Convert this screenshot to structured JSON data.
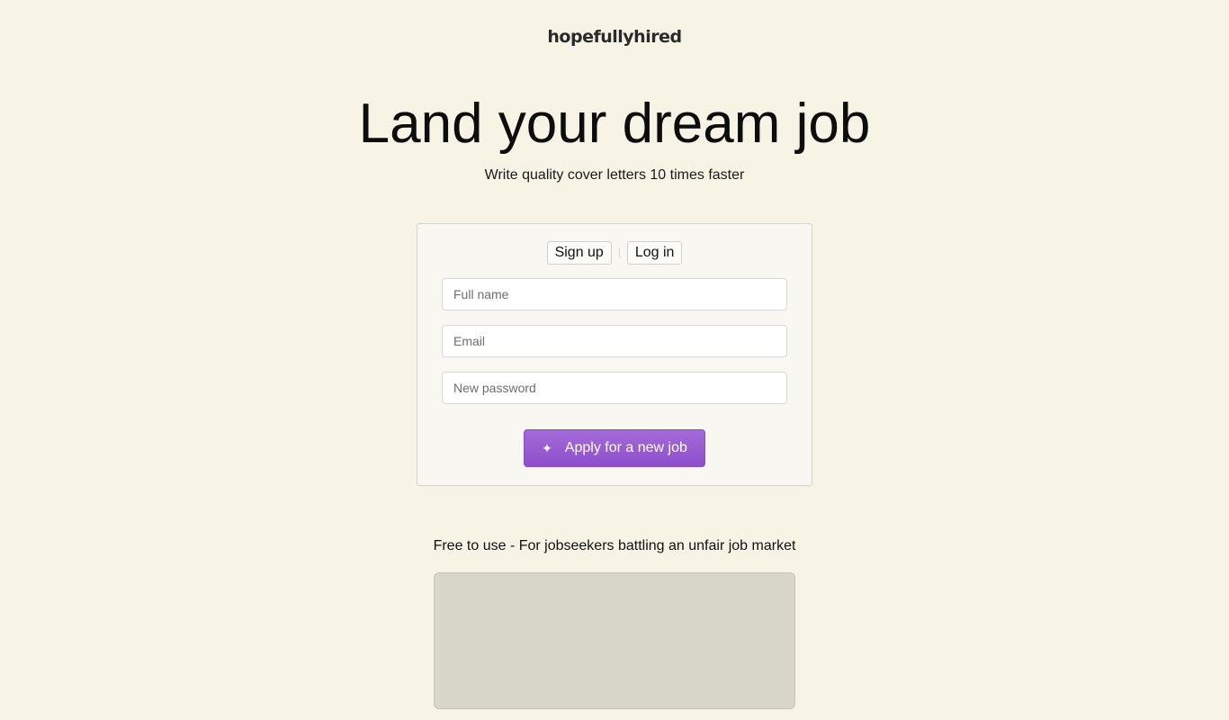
{
  "brand": {
    "logo_text": "hopefullyhired"
  },
  "hero": {
    "headline": "Land your dream job",
    "subheadline": "Write quality cover letters 10 times faster"
  },
  "auth": {
    "tabs": [
      {
        "label": "Sign up"
      },
      {
        "label": "Log in"
      }
    ],
    "fields": {
      "full_name": {
        "placeholder": "Full name",
        "value": ""
      },
      "email": {
        "placeholder": "Email",
        "value": ""
      },
      "new_password": {
        "placeholder": "New password",
        "value": ""
      }
    },
    "submit": {
      "label": "Apply for a new job",
      "icon": "sparkle-icon"
    }
  },
  "tagline": "Free to use - For jobseekers battling an unfair job market",
  "colors": {
    "background": "#f7f4e6",
    "accent": "#9b5fd3",
    "placeholder_box": "#d9d7c7"
  }
}
